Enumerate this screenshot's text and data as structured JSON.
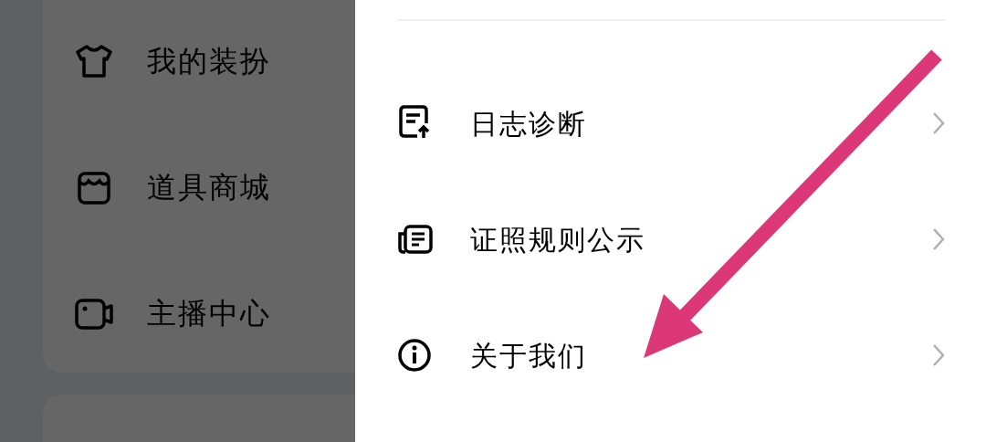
{
  "left_menu": {
    "items": [
      {
        "label": "我的装扮"
      },
      {
        "label": "道具商城"
      },
      {
        "label": "主播中心"
      }
    ]
  },
  "settings": {
    "items": [
      {
        "label": "日志诊断"
      },
      {
        "label": "证照规则公示"
      },
      {
        "label": "关于我们"
      }
    ]
  }
}
